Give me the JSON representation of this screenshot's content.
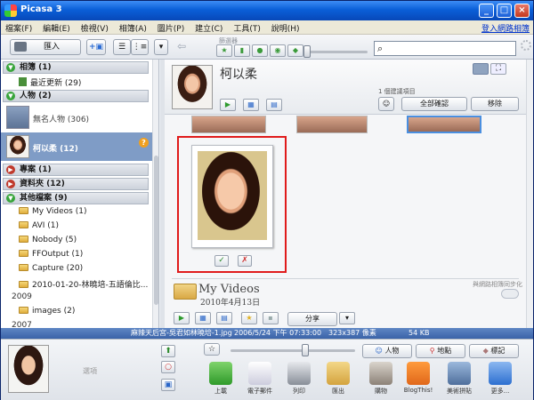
{
  "window": {
    "title": "Picasa 3",
    "minimize": "_",
    "maximize": "□",
    "close": "×"
  },
  "menu": {
    "items": [
      "檔案(F)",
      "編輯(E)",
      "檢視(V)",
      "相簿(A)",
      "圖片(P)",
      "建立(C)",
      "工具(T)",
      "說明(H)"
    ],
    "signin": "登入網路相簿"
  },
  "toolbar": {
    "import_label": "匯入",
    "filter_label": "篩選器"
  },
  "search": {
    "placeholder": ""
  },
  "sidebar": {
    "sections": [
      {
        "label": "相簿 (1)"
      },
      {
        "label": "人物 (2)"
      },
      {
        "label": "專案 (1)"
      },
      {
        "label": "資料夾 (12)"
      },
      {
        "label": "其他檔案 (9)"
      }
    ],
    "recent": "最近更新 (29)",
    "people": [
      {
        "label": "無名人物 (306)"
      },
      {
        "label": "柯以柔 (12)",
        "badge": "?"
      }
    ],
    "folders": [
      "My Videos (1)",
      "AVI (1)",
      "Nobody (5)",
      "FFOutput (1)",
      "Capture (20)",
      "2010-01-20-林曉培-五語倫比..."
    ],
    "years": [
      "2009",
      "2007"
    ],
    "folders_2009": [
      "images (2)"
    ]
  },
  "person": {
    "name": "柯以柔",
    "suggest_count": "1 個建議項目",
    "confirm_all": "全部確認",
    "remove": "移除"
  },
  "album": {
    "title": "My Videos",
    "date": "2010年4月13日",
    "sync_label": "與網路相簿同步化",
    "share": "分享"
  },
  "status": {
    "filename": "麻辣天后宮-吳君如林曉培-1.jpg",
    "date": "2006/5/24 下午 07:33:00",
    "dimensions": "323x387 像素",
    "size": "54 KB"
  },
  "tray": {
    "hold_label": "選項",
    "tags": {
      "people": "人物",
      "places": "地點",
      "labels": "標記"
    },
    "actions": [
      "上載",
      "電子郵件",
      "列印",
      "匯出",
      "購物",
      "BlogThis!",
      "美術拼貼",
      "更多..."
    ]
  },
  "colors": {
    "accent": "#0a5fd8",
    "highlight_border": "#e01b1b",
    "selected_row": "#7f9cc6",
    "statusbar": "#3a63a8"
  }
}
